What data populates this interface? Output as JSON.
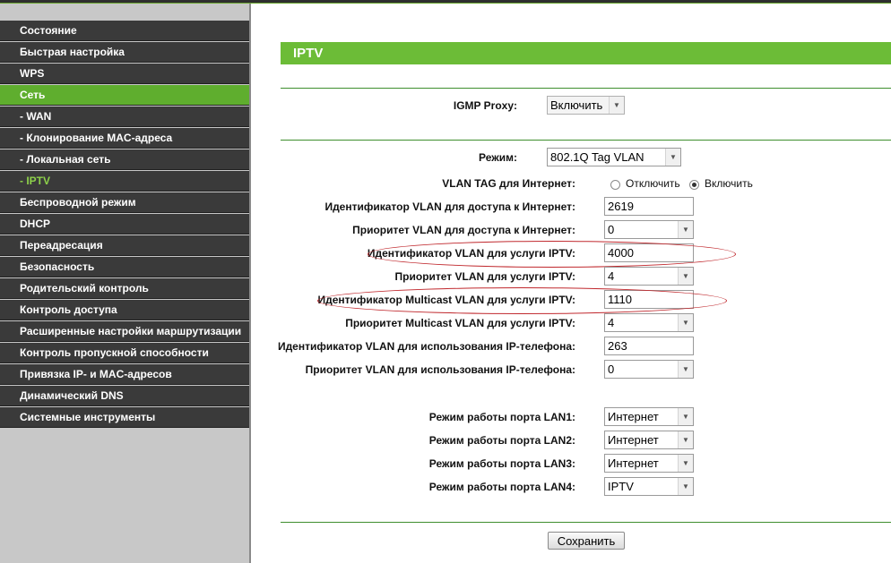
{
  "sidebar": {
    "items": [
      {
        "label": "Состояние"
      },
      {
        "label": "Быстрая настройка"
      },
      {
        "label": "WPS"
      },
      {
        "label": "Сеть"
      },
      {
        "label": "- WAN"
      },
      {
        "label": "- Клонирование MAC-адреса"
      },
      {
        "label": "- Локальная сеть"
      },
      {
        "label": "- IPTV"
      },
      {
        "label": "Беспроводной режим"
      },
      {
        "label": "DHCP"
      },
      {
        "label": "Переадресация"
      },
      {
        "label": "Безопасность"
      },
      {
        "label": "Родительский контроль"
      },
      {
        "label": "Контроль доступа"
      },
      {
        "label": "Расширенные настройки маршрутизации"
      },
      {
        "label": "Контроль пропускной способности"
      },
      {
        "label": "Привязка IP- и MAC-адресов"
      },
      {
        "label": "Динамический DNS"
      },
      {
        "label": "Системные инструменты"
      }
    ]
  },
  "colors": {
    "accent": "#6cbc37",
    "menu_bg": "#3a3a3a",
    "highlight": "#c0282d"
  },
  "main": {
    "title": "IPTV",
    "igmp": {
      "label": "IGMP Proxy:",
      "value": "Включить"
    },
    "mode": {
      "label": "Режим:",
      "value": "802.1Q Tag VLAN"
    },
    "vlan_tag": {
      "label": "VLAN TAG для Интернет:",
      "off": "Отключить",
      "on": "Включить",
      "selected": "on"
    },
    "internet_vlan_id": {
      "label": "Идентификатор VLAN для доступа к Интернет:",
      "value": "2619"
    },
    "internet_vlan_prio": {
      "label": "Приоритет VLAN для доступа к Интернет:",
      "value": "0"
    },
    "iptv_vlan_id": {
      "label": "Идентификатор VLAN для услуги IPTV:",
      "value": "4000"
    },
    "iptv_vlan_prio": {
      "label": "Приоритет VLAN для услуги IPTV:",
      "value": "4"
    },
    "mcast_vlan_id": {
      "label": "Идентификатор Multicast VLAN для услуги IPTV:",
      "value": "1110"
    },
    "mcast_vlan_prio": {
      "label": "Приоритет Multicast VLAN для услуги IPTV:",
      "value": "4"
    },
    "phone_vlan_id": {
      "label": "Идентификатор VLAN для использования IP-телефона:",
      "value": "263"
    },
    "phone_vlan_prio": {
      "label": "Приоритет VLAN для использования IP-телефона:",
      "value": "0"
    },
    "lan1": {
      "label": "Режим работы порта LAN1:",
      "value": "Интернет"
    },
    "lan2": {
      "label": "Режим работы порта LAN2:",
      "value": "Интернет"
    },
    "lan3": {
      "label": "Режим работы порта LAN3:",
      "value": "Интернет"
    },
    "lan4": {
      "label": "Режим работы порта LAN4:",
      "value": "IPTV"
    },
    "save_label": "Сохранить"
  }
}
